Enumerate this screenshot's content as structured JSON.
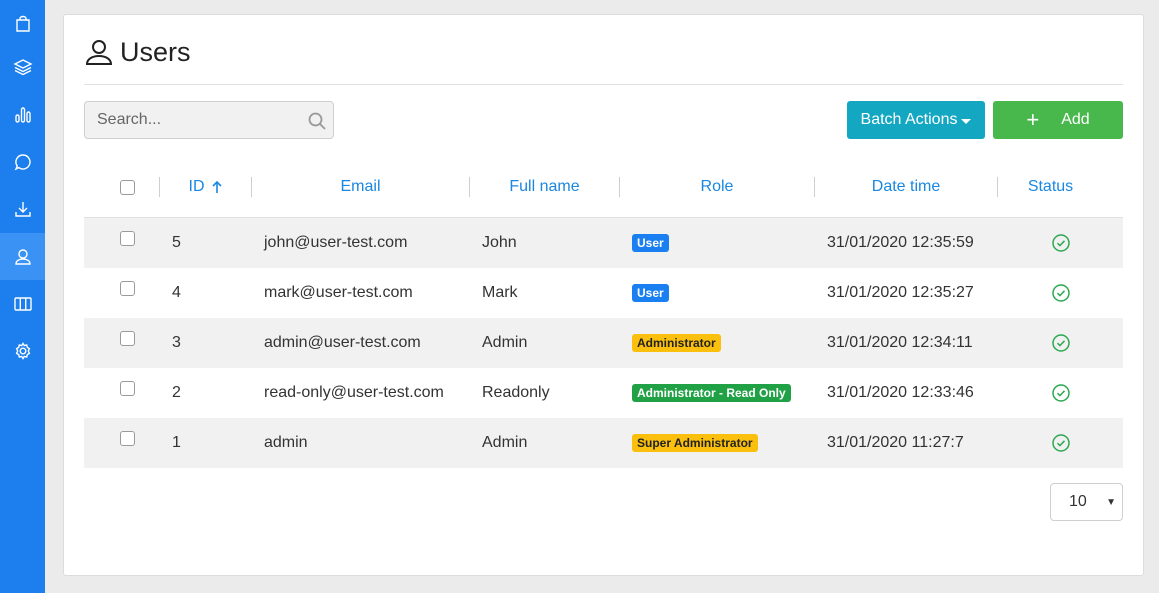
{
  "sidebar": {
    "items": [
      {
        "icon": "bag-icon"
      },
      {
        "icon": "layers-icon"
      },
      {
        "icon": "bar-chart-icon"
      },
      {
        "icon": "chat-icon"
      },
      {
        "icon": "download-icon"
      },
      {
        "icon": "user-icon",
        "active": true
      },
      {
        "icon": "columns-icon"
      },
      {
        "icon": "settings-icon"
      }
    ]
  },
  "page": {
    "title": "Users"
  },
  "search": {
    "placeholder": "Search..."
  },
  "toolbar": {
    "batch_label": "Batch Actions",
    "add_label": "Add"
  },
  "table": {
    "headers": {
      "id": "ID",
      "email": "Email",
      "fullname": "Full name",
      "role": "Role",
      "datetime": "Date time",
      "status": "Status"
    },
    "sort": {
      "column": "id",
      "direction": "ascending"
    },
    "rows": [
      {
        "id": "5",
        "email": "john@user-test.com",
        "fullname": "John",
        "role": "User",
        "role_color": "#1a7ff0",
        "role_text_color": "#ffffff",
        "datetime": "31/01/2020 12:35:59",
        "status": "active"
      },
      {
        "id": "4",
        "email": "mark@user-test.com",
        "fullname": "Mark",
        "role": "User",
        "role_color": "#1a7ff0",
        "role_text_color": "#ffffff",
        "datetime": "31/01/2020 12:35:27",
        "status": "active"
      },
      {
        "id": "3",
        "email": "admin@user-test.com",
        "fullname": "Admin",
        "role": "Administrator",
        "role_color": "#fbbf0d",
        "role_text_color": "#222222",
        "datetime": "31/01/2020 12:34:11",
        "status": "active"
      },
      {
        "id": "2",
        "email": "read-only@user-test.com",
        "fullname": "Readonly",
        "role": "Administrator - Read Only",
        "role_color": "#21a146",
        "role_text_color": "#ffffff",
        "datetime": "31/01/2020 12:33:46",
        "status": "active"
      },
      {
        "id": "1",
        "email": "admin",
        "fullname": "Admin",
        "role": "Super Administrator",
        "role_color": "#fbbf0d",
        "role_text_color": "#222222",
        "datetime": "31/01/2020 11:27:7",
        "status": "active"
      }
    ]
  },
  "pagination": {
    "per_page": "10"
  },
  "colors": {
    "sidebar": "#1d7fee",
    "accent": "#1a87e0",
    "batch": "#14a7c1",
    "add": "#48b84c",
    "status_ok": "#2aa84f"
  }
}
